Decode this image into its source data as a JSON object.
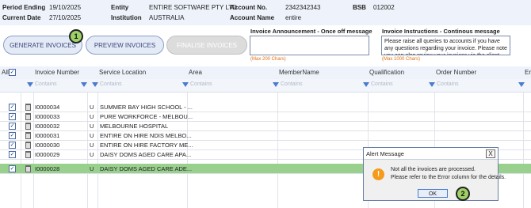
{
  "header": {
    "period_ending_label": "Period Ending",
    "period_ending_value": "19/10/2025",
    "current_date_label": "Current Date",
    "current_date_value": "27/10/2025",
    "entity_label": "Entity",
    "entity_value": "ENTIRE SOFTWARE PTY LTD",
    "institution_label": "Institution",
    "institution_value": "AUSTRALIA",
    "account_no_label": "Account No.",
    "account_no_value": "2342342343",
    "account_name_label": "Account Name",
    "account_name_value": "entire",
    "bsb_label": "BSB",
    "bsb_value": "012002"
  },
  "toolbar": {
    "generate_label": "GENERATE INVOICES",
    "preview_label": "PREVIEW INVOICES",
    "finalise_label": "FINALISE INVOICES",
    "step1": "1",
    "step2": "2"
  },
  "announcement": {
    "label": "Invoice Announcement - Once off message",
    "max": "(Max 200  Chars)",
    "value": ""
  },
  "instructions": {
    "label": "Invoice Instructions - Continous message",
    "max": "(Max 1000  Chars)",
    "value": "Please raise all queries to accounts if you have any questions regarding your invoice. Please note you can also review your invoices via the client"
  },
  "grid": {
    "all_label": "All",
    "columns": [
      "Invoice Number",
      "Service Location",
      "Area",
      "MemberName",
      "Qualification",
      "Order Number",
      "Er"
    ],
    "filter_placeholder": "Contains",
    "rows": [
      {
        "invoice": "I0000034",
        "u": "U",
        "location": "SUMMER BAY HIGH SCHOOL - ..."
      },
      {
        "invoice": "I0000033",
        "u": "U",
        "location": "PURE WORKFORCE - MELBOU..."
      },
      {
        "invoice": "I0000032",
        "u": "U",
        "location": "MELBOURNE HOSPITAL"
      },
      {
        "invoice": "I0000031",
        "u": "U",
        "location": "ENTIRE ON HIRE NDIS MELBO..."
      },
      {
        "invoice": "I0000030",
        "u": "U",
        "location": "ENTIRE ON HIRE FACTORY ME..."
      },
      {
        "invoice": "I0000029",
        "u": "U",
        "location": "DAISY DOMS AGED CARE APA..."
      },
      {
        "invoice": "I0000028",
        "u": "U",
        "location": "DAISY DOMS AGED CARE ADE..."
      }
    ]
  },
  "dialog": {
    "title": "Alert Message",
    "close": "X",
    "line1": "Not all the invoices are processed.",
    "line2": "Please refer to the Error column for the details.",
    "ok_label": "OK",
    "warn_glyph": "!"
  }
}
